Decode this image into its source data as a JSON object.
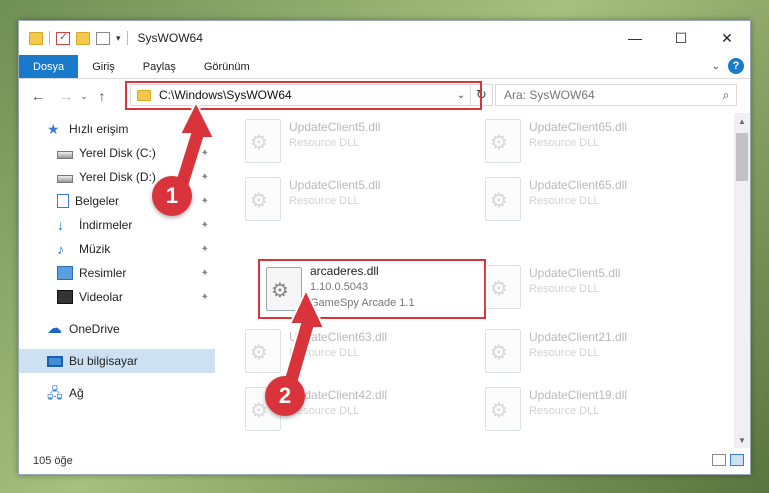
{
  "window": {
    "title": "SysWOW64",
    "minimize_glyph": "—",
    "maximize_glyph": "☐",
    "close_glyph": "✕"
  },
  "ribbon": {
    "tabs": [
      {
        "label": "Dosya",
        "active": true
      },
      {
        "label": "Giriş"
      },
      {
        "label": "Paylaş"
      },
      {
        "label": "Görünüm"
      }
    ],
    "help_glyph": "?"
  },
  "nav": {
    "back_glyph": "←",
    "forward_glyph": "→",
    "recent_glyph": "⌄",
    "up_glyph": "↑",
    "address": "C:\\Windows\\SysWOW64",
    "refresh_glyph": "↻",
    "search_placeholder": "Ara: SysWOW64",
    "search_glyph": "⌕"
  },
  "sidebar": {
    "items": [
      {
        "label": "Hızlı erişim",
        "icon": "star-icon"
      },
      {
        "label": "Yerel Disk (C:)",
        "icon": "disk-icon",
        "pinned": true
      },
      {
        "label": "Yerel Disk (D:)",
        "icon": "disk-icon",
        "pinned": true
      },
      {
        "label": "Belgeler",
        "icon": "document-icon",
        "pinned": true
      },
      {
        "label": "İndirmeler",
        "icon": "download-icon",
        "pinned": true
      },
      {
        "label": "Müzik",
        "icon": "music-icon",
        "pinned": true
      },
      {
        "label": "Resimler",
        "icon": "pictures-icon",
        "pinned": true
      },
      {
        "label": "Videolar",
        "icon": "video-icon",
        "pinned": true
      },
      {
        "label": "OneDrive",
        "icon": "cloud-icon"
      },
      {
        "label": "Bu bilgisayar",
        "icon": "computer-icon",
        "selected": true
      },
      {
        "label": "Ağ",
        "icon": "network-icon"
      }
    ],
    "pin_glyph": "✦"
  },
  "files": [
    {
      "name": "UpdateClient5.dll",
      "meta": "Resource DLL"
    },
    {
      "name": "UpdateClient65.dll",
      "meta": "Resource DLL"
    },
    {
      "name": "UpdateClient5.dll",
      "meta": "Resource DLL"
    },
    {
      "name": "UpdateClient65.dll",
      "meta": "Resource DLL"
    },
    {
      "name": "arcaderes.dll",
      "meta": "1.10.0.5043",
      "meta2": "GameSpy Arcade 1.1",
      "highlighted": true
    },
    {
      "name": "UpdateClient5.dll",
      "meta": "Resource DLL"
    },
    {
      "name": "UpdateClient63.dll",
      "meta": "Resource DLL"
    },
    {
      "name": "UpdateClient21.dll",
      "meta": "Resource DLL"
    },
    {
      "name": "UpdateClient42.dll",
      "meta": "Resource DLL"
    },
    {
      "name": "UpdateClient19.dll",
      "meta": "Resource DLL"
    }
  ],
  "status": {
    "count": "105 öğe"
  },
  "annotations": {
    "step1": "1",
    "step2": "2",
    "color": "#d9343b"
  },
  "colors": {
    "accent": "#1979ca",
    "selection": "#cde1f3"
  }
}
